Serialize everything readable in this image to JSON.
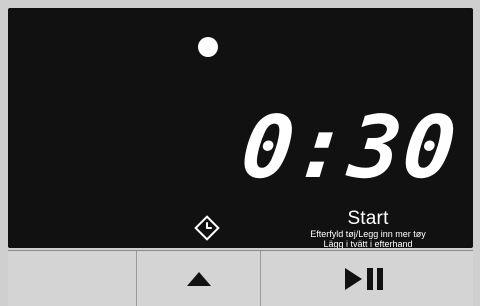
{
  "display": {
    "time": "0:30",
    "start_label": "Start",
    "start_sub_line_1": "Efterfyld tøj/Legg inn mer tøy",
    "start_sub_line_2": "Lägg i tvätt i efterhand"
  },
  "icons": {
    "indicator": "status-dot-icon",
    "delay": "clock-diamond-icon",
    "up": "triangle-up-icon",
    "play_pause": "play-pause-icon"
  },
  "buttons": {
    "left": "blank-button",
    "middle": "up-button",
    "right": "play-pause-button"
  },
  "colors": {
    "screen_bg": "#111111",
    "text": "#ffffff",
    "button_bg": "#d4d4d4"
  }
}
